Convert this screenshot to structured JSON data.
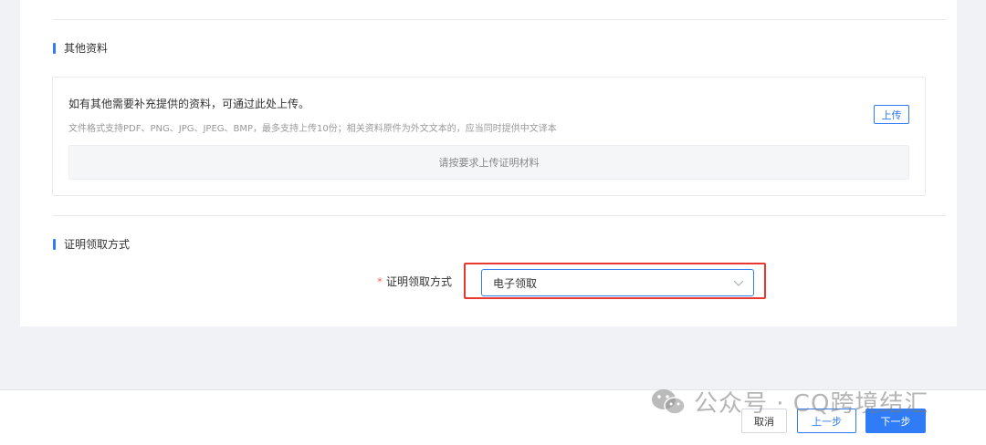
{
  "other_materials": {
    "title": "其他资料",
    "main_text": "如有其他需要补充提供的资料，可通过此处上传。",
    "hint": "文件格式支持PDF、PNG、JPG、JPEG、BMP，最多支持上传10份；相关资料原件为外文文本的，应当同时提供中文译本",
    "upload_button": "上传",
    "drop_placeholder": "请按要求上传证明材料"
  },
  "certificate_method": {
    "title": "证明领取方式",
    "field_label": "证明领取方式",
    "required_mark": "*",
    "selected_value": "电子领取"
  },
  "footer": {
    "cancel": "取消",
    "prev": "上一步",
    "next": "下一步"
  },
  "watermark": {
    "text": "公众号 · CQ跨境结汇"
  },
  "colors": {
    "accent": "#2f7cf6",
    "highlight": "#e8382f",
    "required": "#f56c6c"
  }
}
